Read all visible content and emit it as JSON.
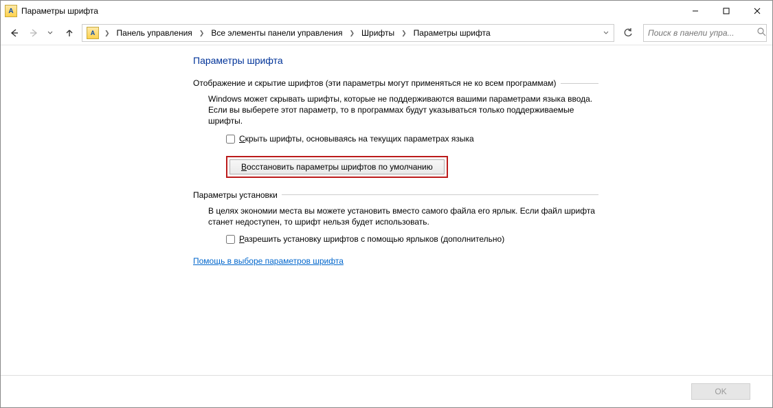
{
  "window": {
    "title": "Параметры шрифта"
  },
  "nav": {
    "breadcrumbs": [
      "Панель управления",
      "Все элементы панели управления",
      "Шрифты",
      "Параметры шрифта"
    ],
    "search_placeholder": "Поиск в панели упра..."
  },
  "page": {
    "heading": "Параметры шрифта",
    "section1": {
      "title": "Отображение и скрытие шрифтов (эти параметры могут применяться не ко всем программам)",
      "desc": "Windows может скрывать шрифты, которые не поддерживаются вашими параметрами языка ввода. Если вы выберете этот параметр, то в программах будут указываться только поддерживаемые шрифты.",
      "check_prefix": "С",
      "check_rest": "крыть шрифты, основываясь на текущих параметрах языка",
      "restore_prefix": "В",
      "restore_rest": "осстановить параметры шрифтов по умолчанию"
    },
    "section2": {
      "title": "Параметры установки",
      "desc": "В целях экономии места вы можете установить вместо самого файла его ярлык. Если файл шрифта станет недоступен, то шрифт нельзя будет использовать.",
      "check_prefix": "Р",
      "check_rest": "азрешить установку шрифтов с помощью ярлыков (дополнительно)"
    },
    "help_link": "Помощь в выборе параметров шрифта"
  },
  "footer": {
    "ok_label": "OK"
  }
}
